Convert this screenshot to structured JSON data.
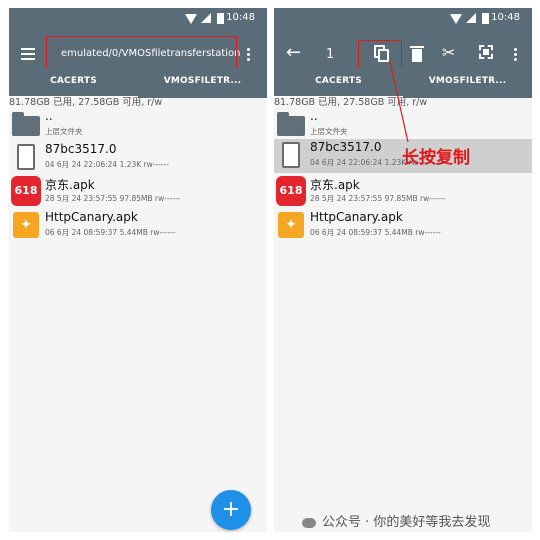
{
  "status_bar": {
    "time": "10:48"
  },
  "tabs": [
    "CACERTS",
    "VMOSFILETR..."
  ],
  "storage_info": "81.78GB 已用, 27.58GB 可用, r/w",
  "left_screen": {
    "path": "emulated/0/VMOSfiletransferstation"
  },
  "right_screen": {
    "selection_count": "1",
    "annotation": "长按复制"
  },
  "files": [
    {
      "name": "..",
      "meta": "上层文件夹",
      "icon": "folder-icon"
    },
    {
      "name": "87bc3517.0",
      "meta": "04 6月 24 22:06:24  1.23K  rw------",
      "icon": "file-icon"
    },
    {
      "name": "京东.apk",
      "meta": "28 5月 24 23:57:55  97.85MB  rw------",
      "icon": "jd-app-icon",
      "badge": "618"
    },
    {
      "name": "HttpCanary.apk",
      "meta": "06 6月 24 08:59:37  5.44MB  rw------",
      "icon": "httpcanary-app-icon"
    }
  ],
  "fab": {
    "symbol": "+"
  },
  "watermark": "公众号 · 你的美好等我去发现",
  "colors": {
    "toolbar": "#596c78",
    "fab": "#1e90e8",
    "annotation_red": "#e0191c",
    "selected_row": "#cfcfcf"
  }
}
